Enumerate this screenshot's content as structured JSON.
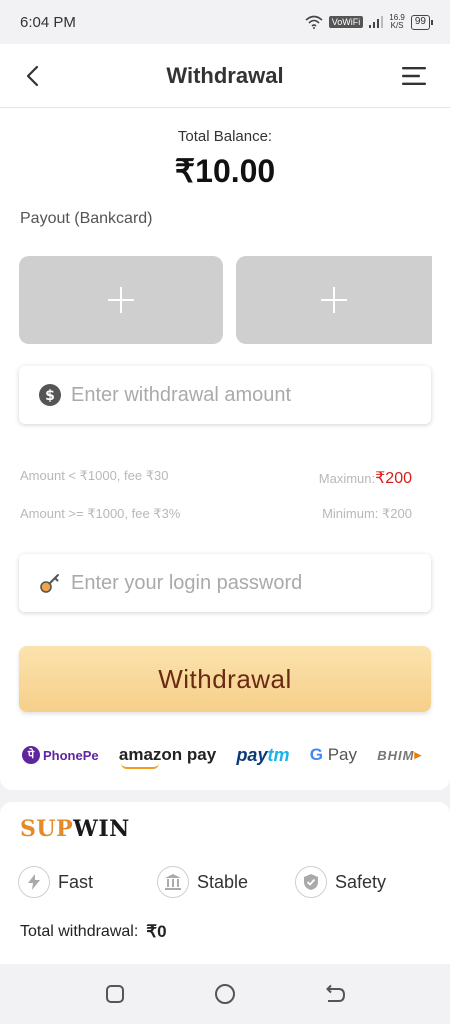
{
  "status_bar": {
    "time": "6:04 PM",
    "vowifi": "VoWiFi",
    "speed_value": "16.9",
    "speed_unit": "K/S",
    "battery": "99"
  },
  "header": {
    "title": "Withdrawal",
    "back_icon": "back-chevron-icon",
    "menu_icon": "menu-icon"
  },
  "balance": {
    "label": "Total Balance:",
    "value": "₹10.00"
  },
  "payout": {
    "label": "Payout (Bankcard)",
    "add_icon": "plus-icon"
  },
  "amount_input": {
    "placeholder": "Enter withdrawal amount",
    "value": "",
    "icon": "dollar-coin-icon"
  },
  "fees": {
    "row1_left": "Amount < ₹1000, fee ₹30",
    "row1_right_label": "Maximun:",
    "row1_right_value": "₹200",
    "row2_left": "Amount >= ₹1000, fee ₹3%",
    "row2_right": "Minimum: ₹200"
  },
  "password_input": {
    "placeholder": "Enter your login password",
    "value": "",
    "icon": "key-icon"
  },
  "withdraw_button": {
    "label": "Withdrawal"
  },
  "payment_logos": {
    "phonepe": "PhonePe",
    "phonepe_mark": "पे",
    "amazon": "amazon pay",
    "paytm_pay": "pay",
    "paytm_tm": "tm",
    "gpay_g": "G",
    "gpay_pay": "Pay",
    "bhim": "BHIM"
  },
  "brand": {
    "sup": "SUP",
    "win": "WIN"
  },
  "features": [
    {
      "label": "Fast",
      "icon": "lightning-icon"
    },
    {
      "label": "Stable",
      "icon": "bank-icon"
    },
    {
      "label": "Safety",
      "icon": "shield-check-icon"
    }
  ],
  "total_withdrawal": {
    "label": "Total withdrawal:",
    "value": "₹0"
  },
  "colors": {
    "accent_red": "#d71e1e",
    "button_gradient_top": "#fbe3ad",
    "button_gradient_bottom": "#f6cf8a",
    "button_text": "#6b2a12",
    "brand_orange": "#e48a2a"
  }
}
